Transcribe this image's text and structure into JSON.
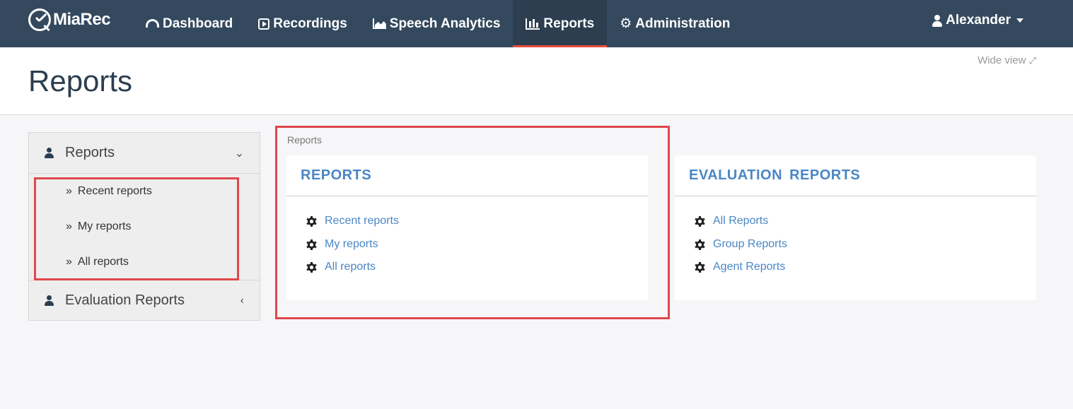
{
  "navbar": {
    "brand": "MiaRec",
    "items": [
      {
        "label": "Dashboard",
        "icon": "dashboard-icon"
      },
      {
        "label": "Recordings",
        "icon": "play-square-icon"
      },
      {
        "label": "Speech Analytics",
        "icon": "area-chart-icon"
      },
      {
        "label": "Reports",
        "icon": "bar-chart-icon",
        "active": true
      },
      {
        "label": "Administration",
        "icon": "gear-icon"
      }
    ],
    "user": "Alexander"
  },
  "header": {
    "title": "Reports",
    "wide_view": "Wide view"
  },
  "sidebar": {
    "groups": [
      {
        "label": "Reports",
        "expanded": true,
        "items": [
          "Recent reports",
          "My reports",
          "All reports"
        ]
      },
      {
        "label": "Evaluation Reports",
        "expanded": false
      }
    ]
  },
  "breadcrumb": "Reports",
  "panels": [
    {
      "title": "REPORTS",
      "links": [
        "Recent reports",
        "My reports",
        "All reports"
      ]
    },
    {
      "title": "EVALUATION REPORTS",
      "links": [
        "All Reports",
        "Group Reports",
        "Agent Reports"
      ]
    }
  ],
  "colors": {
    "navbar": "#34495e",
    "active_underline": "#e74c3c",
    "link": "#4a86c5",
    "highlight": "#e0474c"
  }
}
